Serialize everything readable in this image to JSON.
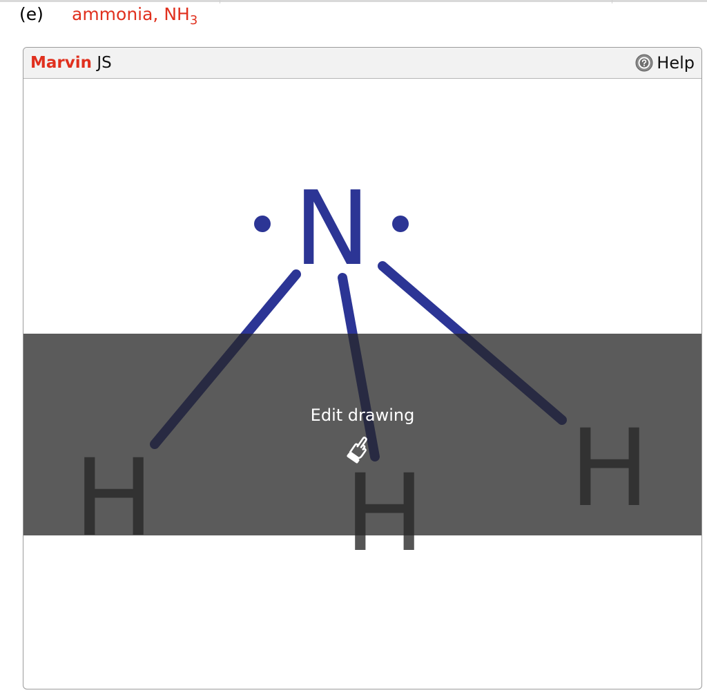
{
  "question": {
    "label": "(e)",
    "text": "ammonia, NH",
    "subscript": "3"
  },
  "editor": {
    "brand_name": "Marvin",
    "brand_suffix": " JS",
    "help_label": "Help",
    "overlay_label": "Edit drawing"
  },
  "molecule": {
    "center_atom": "N",
    "outer_atoms": [
      "H",
      "H",
      "H"
    ],
    "lone_pair_electrons": 2
  },
  "colors": {
    "brand_red": "#e0301e",
    "nitrogen": "#2c3595",
    "hydrogen": "#555555",
    "overlay": "#5a5a5a"
  },
  "icons": {
    "help": "question-circle-icon",
    "overlay": "pointing-hand-icon"
  }
}
